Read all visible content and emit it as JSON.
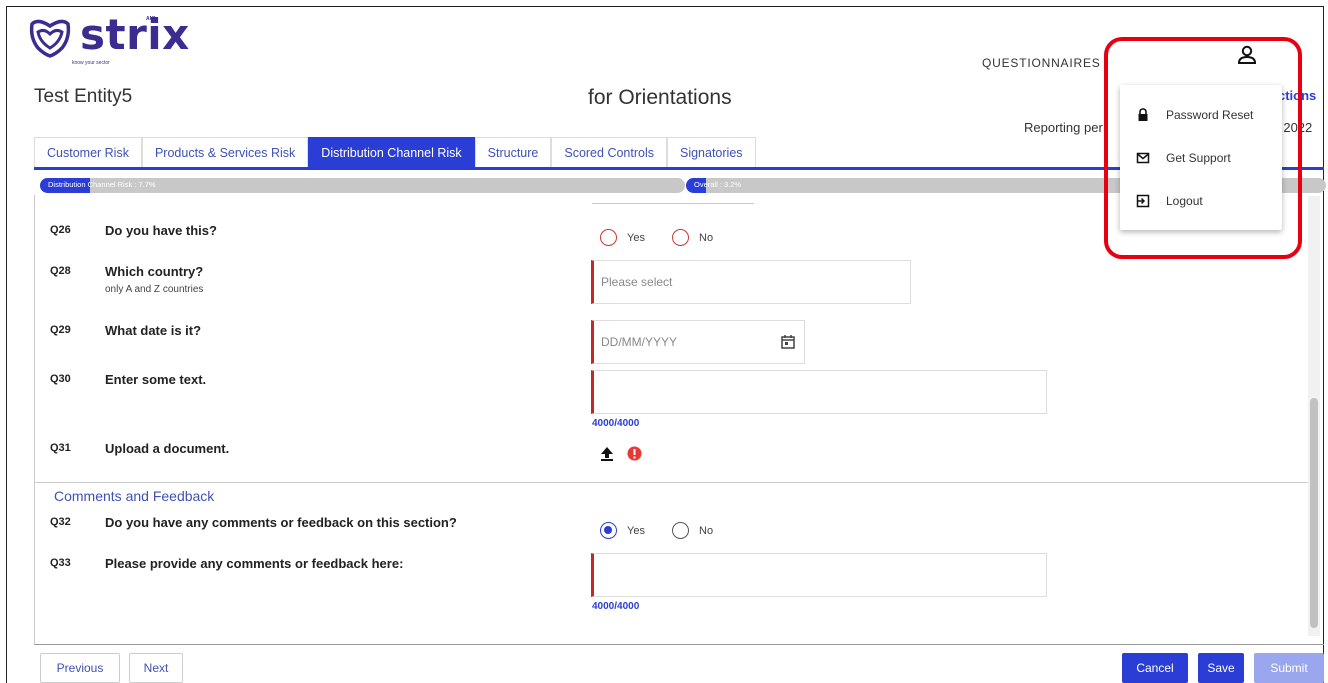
{
  "brand": {
    "name": "strix",
    "aml": "AML",
    "tagline": "know your sector"
  },
  "nav": {
    "questionnaires": "QUESTIONNAIRES"
  },
  "header": {
    "entity": "Test Entity5",
    "title": "for Orientations",
    "instructions_partial": "ctions",
    "period_label": "Reporting per",
    "period_value": "ec 2022"
  },
  "tabs": [
    "Customer Risk",
    "Products & Services Risk",
    "Distribution Channel Risk",
    "Structure",
    "Scored Controls",
    "Signatories"
  ],
  "active_tab": "Distribution Channel Risk",
  "progress": {
    "section": {
      "label": "Distribution Channel Risk : 7.7%",
      "value": 0.077
    },
    "overall": {
      "label": "Overall : 3.2%",
      "value": 0.032
    }
  },
  "questions": [
    {
      "num": "Q26",
      "text": "Do you have this?",
      "type": "radio",
      "options": [
        "Yes",
        "No"
      ]
    },
    {
      "num": "Q28",
      "text": "Which country?",
      "sub": "only A and Z countries",
      "type": "select",
      "placeholder": "Please select"
    },
    {
      "num": "Q29",
      "text": "What date is it?",
      "type": "date",
      "placeholder": "DD/MM/YYYY"
    },
    {
      "num": "Q30",
      "text": "Enter some text.",
      "type": "textarea",
      "counter": "4000/4000"
    },
    {
      "num": "Q31",
      "text": "Upload a document.",
      "type": "upload"
    }
  ],
  "section2": {
    "title": "Comments and Feedback"
  },
  "questions2": [
    {
      "num": "Q32",
      "text": "Do you have any comments or feedback on this section?",
      "type": "radio",
      "options": [
        "Yes",
        "No"
      ],
      "selected": "Yes"
    },
    {
      "num": "Q33",
      "text": "Please provide any comments or feedback here:",
      "type": "textarea",
      "counter": "4000/4000"
    }
  ],
  "buttons": {
    "previous": "Previous",
    "next": "Next",
    "cancel": "Cancel",
    "save": "Save",
    "submit": "Submit"
  },
  "user_menu": {
    "items": [
      {
        "label": "Password Reset",
        "icon": "lock-icon"
      },
      {
        "label": "Get Support",
        "icon": "mail-icon"
      },
      {
        "label": "Logout",
        "icon": "logout-icon"
      }
    ]
  },
  "colors": {
    "primary": "#2a3ed6",
    "brand": "#3d2c8f",
    "required": "#c62828",
    "highlight": "#e60012"
  }
}
